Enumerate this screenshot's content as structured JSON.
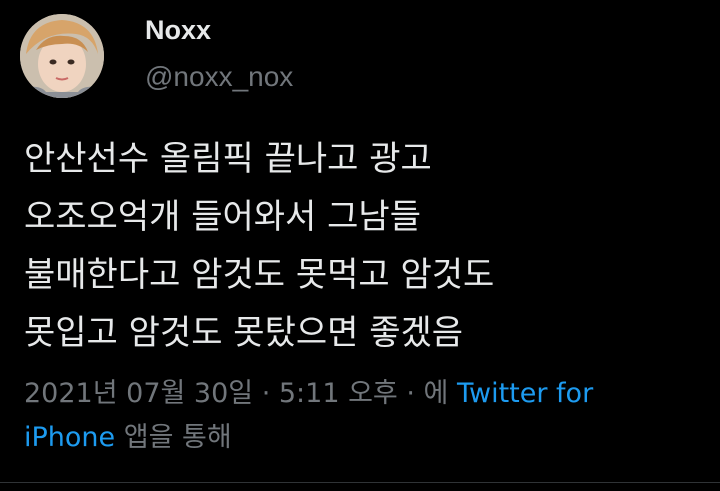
{
  "author": {
    "display_name": "Noxx",
    "handle": "@noxx_nox",
    "avatar_icon": "profile-photo-avatar"
  },
  "tweet": {
    "lines": [
      "안산선수 올림픽 끝나고 광고",
      "오조오억개 들어와서 그남들",
      "불매한다고 암것도 못먹고 암것도",
      "못입고 암것도 못탔으면 좋겠음"
    ]
  },
  "meta": {
    "date": "2021년 07월 30일",
    "separator": " · ",
    "time": "5:11 오후",
    "via_prefix": "에 ",
    "source_part1": "Twitter for",
    "source_part2": "iPhone",
    "via_suffix": " 앱을 통해"
  },
  "colors": {
    "background": "#000000",
    "primary_text": "#e7e9ea",
    "secondary_text": "#71767b",
    "link": "#1d9bf0"
  }
}
